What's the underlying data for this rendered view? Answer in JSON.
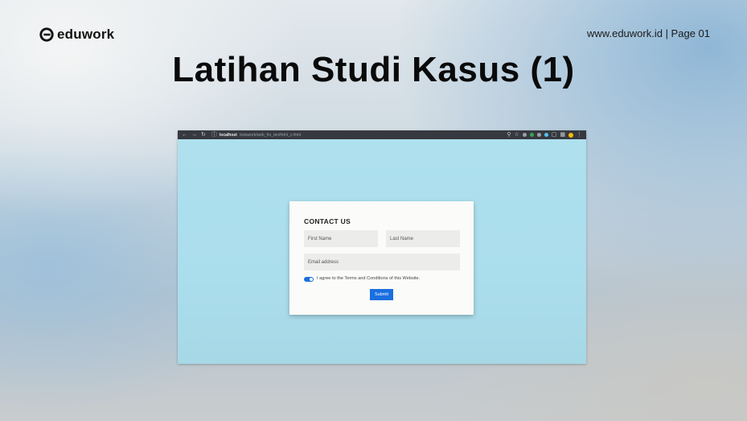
{
  "slide": {
    "logo_text": "eduwork",
    "page_ref": "www.eduwork.id | Page 01",
    "title": "Latihan Studi Kasus (1)"
  },
  "browser": {
    "url_host": "localhost",
    "url_path": "/eduwork/web_fro_ten/html_c.html"
  },
  "form": {
    "title": "CONTACT US",
    "first_name_placeholder": "First Name",
    "last_name_placeholder": "Last Name",
    "email_placeholder": "Email address",
    "agree_label": "I agree to the Terms and Conditions of this Website.",
    "agree_checked": true,
    "submit_label": "Submit"
  },
  "colors": {
    "accent": "#1a6fe0",
    "page_bg": "#aee0ee"
  }
}
